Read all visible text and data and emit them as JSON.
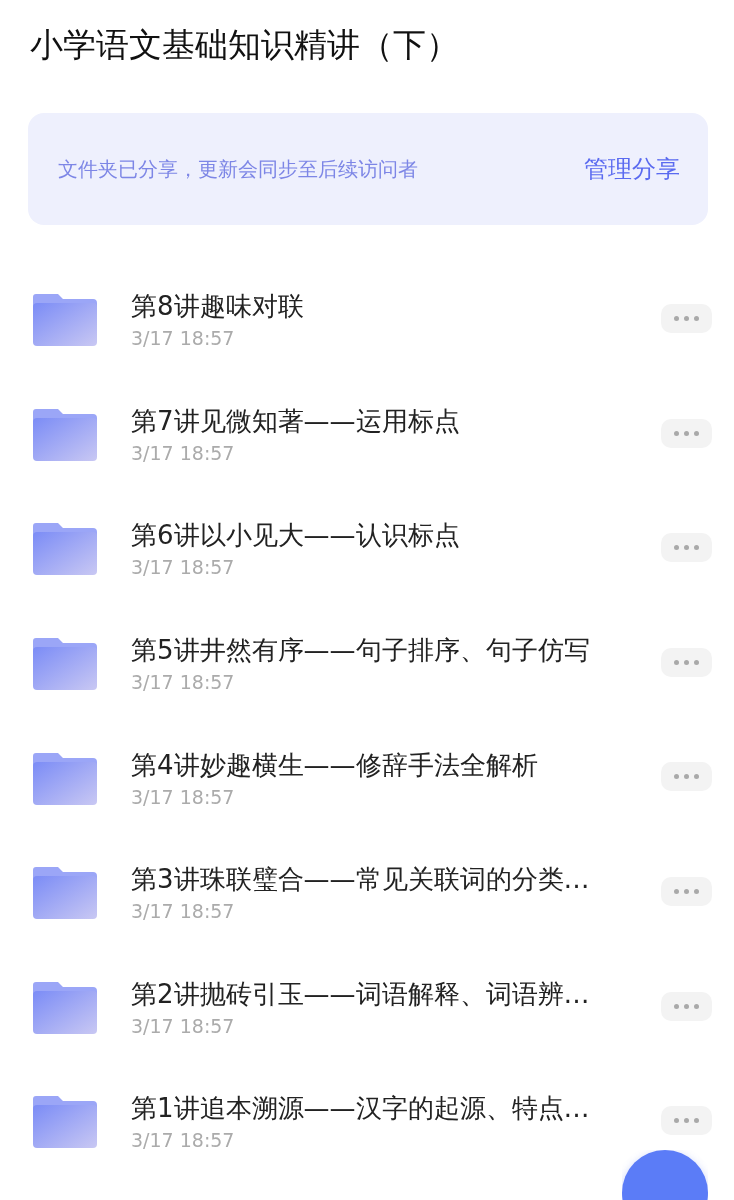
{
  "title": "小学语文基础知识精讲（下）",
  "share_banner": {
    "message": "文件夹已分享，更新会同步至后续访问者",
    "action": "管理分享"
  },
  "folders": [
    {
      "name": "第8讲趣味对联",
      "date": "3/17 18:57"
    },
    {
      "name": "第7讲见微知著——运用标点",
      "date": "3/17 18:57"
    },
    {
      "name": "第6讲以小见大——认识标点",
      "date": "3/17 18:57"
    },
    {
      "name": "第5讲井然有序——句子排序、句子仿写",
      "date": "3/17 18:57"
    },
    {
      "name": "第4讲妙趣横生——修辞手法全解析",
      "date": "3/17 18:57"
    },
    {
      "name": "第3讲珠联璧合——常见关联词的分类…",
      "date": "3/17 18:57"
    },
    {
      "name": "第2讲抛砖引玉——词语解释、词语辨…",
      "date": "3/17 18:57"
    },
    {
      "name": "第1讲追本溯源——汉字的起源、特点…",
      "date": "3/17 18:57"
    }
  ]
}
